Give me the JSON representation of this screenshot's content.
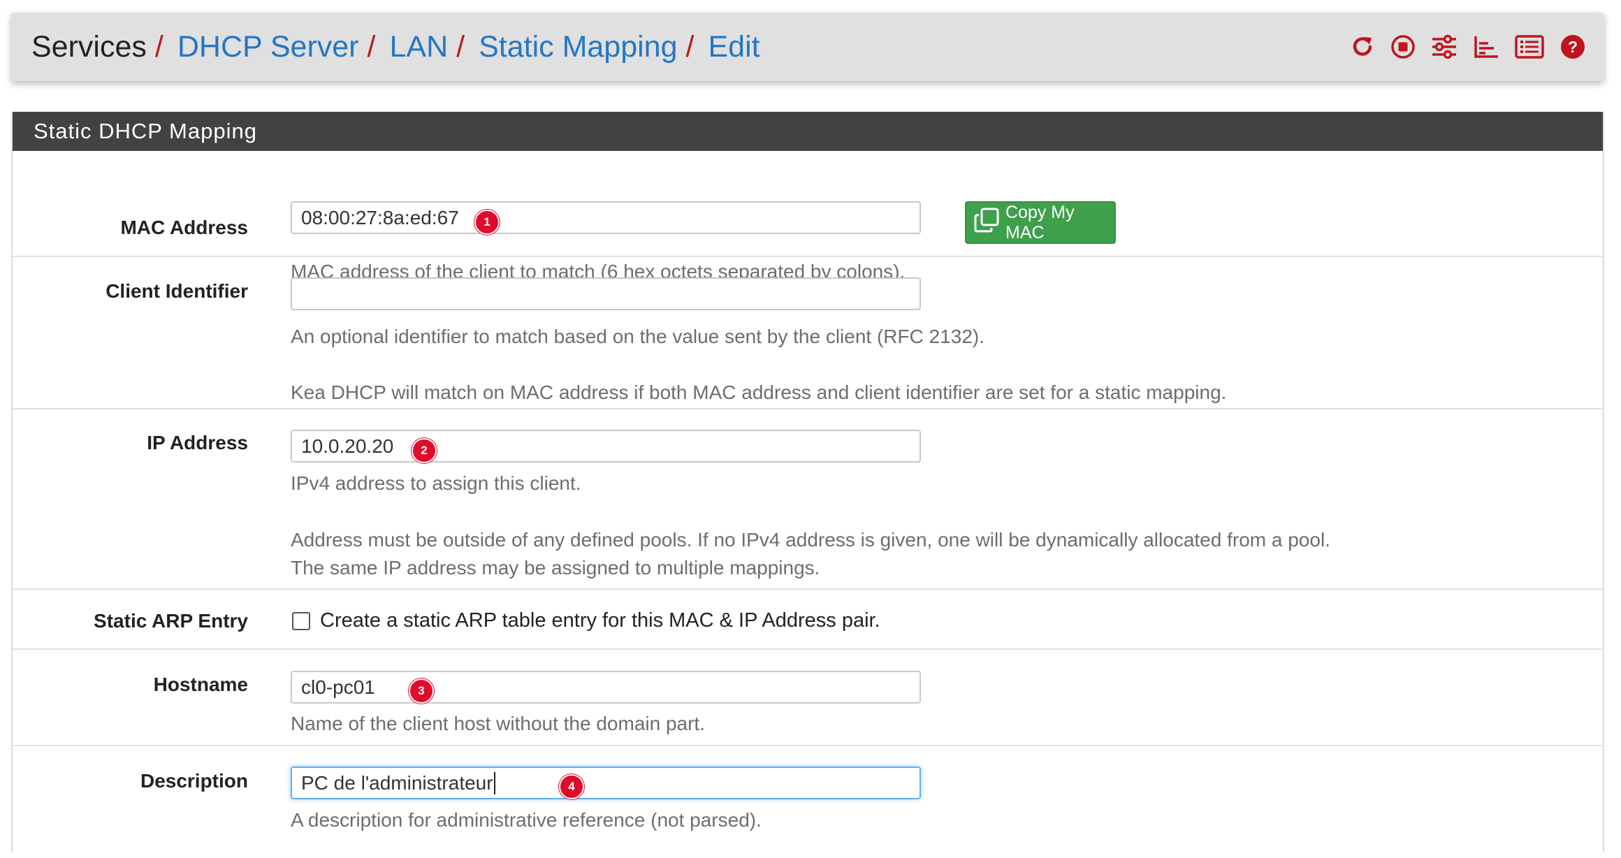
{
  "breadcrumb": {
    "root": "Services",
    "separator": "/",
    "items": [
      "DHCP Server",
      "LAN",
      "Static Mapping",
      "Edit"
    ]
  },
  "toolbar_icons": [
    "reload-icon",
    "stop-icon",
    "settings-sliders-icon",
    "chart-icon",
    "list-icon",
    "help-icon"
  ],
  "panel": {
    "title": "Static DHCP Mapping"
  },
  "mac": {
    "label": "MAC Address",
    "value": "08:00:27:8a:ed:67",
    "badge": "1",
    "copy_button": "Copy My MAC",
    "help": "MAC address of the client to match (6 hex octets separated by colons)."
  },
  "client_id": {
    "label": "Client Identifier",
    "value": "",
    "help1": "An optional identifier to match based on the value sent by the client (RFC 2132).",
    "help2": "Kea DHCP will match on MAC address if both MAC address and client identifier are set for a static mapping."
  },
  "ip": {
    "label": "IP Address",
    "value": "10.0.20.20",
    "badge": "2",
    "help1": "IPv4 address to assign this client.",
    "help2": "Address must be outside of any defined pools. If no IPv4 address is given, one will be dynamically allocated from a pool.",
    "help3": "The same IP address may be assigned to multiple mappings."
  },
  "arp": {
    "label": "Static ARP Entry",
    "checkbox_label": "Create a static ARP table entry for this MAC & IP Address pair.",
    "checked": false
  },
  "hostname": {
    "label": "Hostname",
    "value": "cl0-pc01",
    "badge": "3",
    "help": "Name of the client host without the domain part."
  },
  "description": {
    "label": "Description",
    "value": "PC de l'administrateur",
    "badge": "4",
    "help": "A description for administrative reference (not parsed)."
  },
  "colors": {
    "link": "#2576c4",
    "separator": "#b71c1c",
    "icon": "#c0141d",
    "header_bg": "#424242",
    "button_green": "#3ea04b",
    "badge_red": "#e00b2b"
  }
}
